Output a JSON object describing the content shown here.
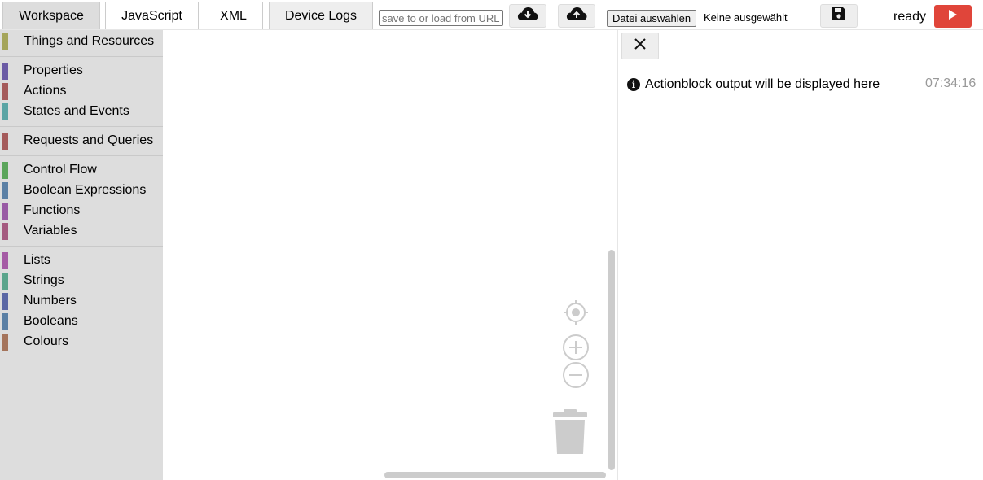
{
  "tabs": [
    {
      "label": "Workspace",
      "active": true
    },
    {
      "label": "JavaScript",
      "active": false
    },
    {
      "label": "XML",
      "active": false
    },
    {
      "label": "Device Logs",
      "active": false
    }
  ],
  "toolbar": {
    "url_placeholder": "save to or load from URL",
    "download_icon": "cloud-download-icon",
    "upload_icon": "cloud-upload-icon",
    "file_button_label": "Datei auswählen",
    "file_status": "Keine ausgewählt",
    "save_icon": "floppy-disk-icon",
    "status": "ready",
    "run_icon": "play-icon",
    "run_color": "#e0453a"
  },
  "toolbox": {
    "categories": [
      {
        "label": "Things and Resources",
        "color": "#a5a55a"
      },
      {
        "label": "Properties",
        "color": "#6b5ba5"
      },
      {
        "label": "Actions",
        "color": "#a55b5b"
      },
      {
        "label": "States and Events",
        "color": "#5ba5a5"
      },
      {
        "label": "Requests and Queries",
        "color": "#a55b5b"
      },
      {
        "label": "Control Flow",
        "color": "#5ba55b"
      },
      {
        "label": "Boolean Expressions",
        "color": "#5b80a5"
      },
      {
        "label": "Functions",
        "color": "#995ba5"
      },
      {
        "label": "Variables",
        "color": "#a55b80"
      },
      {
        "label": "Lists",
        "color": "#a55ba5"
      },
      {
        "label": "Strings",
        "color": "#5ba58c"
      },
      {
        "label": "Numbers",
        "color": "#5b67a5"
      },
      {
        "label": "Booleans",
        "color": "#5b80a5"
      },
      {
        "label": "Colours",
        "color": "#a5745b"
      }
    ]
  },
  "workspace": {
    "recenter_icon": "target-icon",
    "zoom_in_icon": "zoom-in-icon",
    "zoom_out_icon": "zoom-out-icon",
    "trash_icon": "trash-icon"
  },
  "output": {
    "close_icon": "close-icon",
    "info_icon": "info-icon",
    "info_glyph": "i",
    "message": "Actionblock output will be displayed here",
    "timestamp": "07:34:16"
  }
}
